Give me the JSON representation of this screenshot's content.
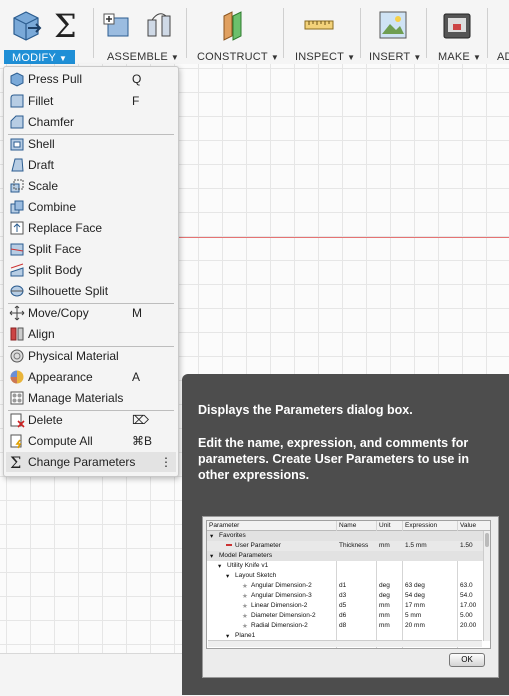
{
  "toolbar": {
    "groups": [
      {
        "label": "MODIFY",
        "active": true
      },
      {
        "label": "ASSEMBLE"
      },
      {
        "label": "CONSTRUCT"
      },
      {
        "label": "INSPECT"
      },
      {
        "label": "INSERT"
      },
      {
        "label": "MAKE"
      },
      {
        "label": "AD"
      }
    ]
  },
  "menu": {
    "items": [
      {
        "label": "Press Pull",
        "key": "Q",
        "icon": "press-pull-icon"
      },
      {
        "label": "Fillet",
        "key": "F",
        "icon": "fillet-icon"
      },
      {
        "label": "Chamfer",
        "key": "",
        "icon": "chamfer-icon"
      },
      {
        "label": "Shell",
        "key": "",
        "icon": "shell-icon"
      },
      {
        "label": "Draft",
        "key": "",
        "icon": "draft-icon"
      },
      {
        "label": "Scale",
        "key": "",
        "icon": "scale-icon"
      },
      {
        "label": "Combine",
        "key": "",
        "icon": "combine-icon"
      },
      {
        "label": "Replace Face",
        "key": "",
        "icon": "replace-face-icon"
      },
      {
        "label": "Split Face",
        "key": "",
        "icon": "split-face-icon"
      },
      {
        "label": "Split Body",
        "key": "",
        "icon": "split-body-icon"
      },
      {
        "label": "Silhouette Split",
        "key": "",
        "icon": "silhouette-split-icon"
      },
      {
        "label": "Move/Copy",
        "key": "M",
        "icon": "move-copy-icon"
      },
      {
        "label": "Align",
        "key": "",
        "icon": "align-icon"
      },
      {
        "label": "Physical Material",
        "key": "",
        "icon": "physical-material-icon"
      },
      {
        "label": "Appearance",
        "key": "A",
        "icon": "appearance-icon"
      },
      {
        "label": "Manage Materials",
        "key": "",
        "icon": "manage-materials-icon"
      },
      {
        "label": "Delete",
        "key": "⌦",
        "icon": "delete-icon"
      },
      {
        "label": "Compute All",
        "key": "⌘B",
        "icon": "compute-all-icon"
      },
      {
        "label": "Change Parameters",
        "key": "⋮",
        "icon": "change-parameters-icon"
      }
    ]
  },
  "tooltip": {
    "line1": "Displays the Parameters dialog box.",
    "line2": "Edit the name, expression, and comments for parameters. Create User Parameters to use in other expressions."
  },
  "dialog": {
    "headers": [
      "Parameter",
      "Name",
      "Unit",
      "Expression",
      "Value"
    ],
    "rows": [
      {
        "param": "Favorites",
        "name": "",
        "unit": "",
        "expr": "",
        "value": "",
        "kind": "grp",
        "indent": 0
      },
      {
        "param": "User Parameter",
        "name": "Thickness",
        "unit": "mm",
        "expr": "1.5 mm",
        "value": "1.50",
        "kind": "hl",
        "indent": 2
      },
      {
        "param": "Model Parameters",
        "name": "",
        "unit": "",
        "expr": "",
        "value": "",
        "kind": "grp",
        "indent": 0
      },
      {
        "param": "Utility Knife v1",
        "name": "",
        "unit": "",
        "expr": "",
        "value": "",
        "kind": "",
        "indent": 1
      },
      {
        "param": "Layout Sketch",
        "name": "",
        "unit": "",
        "expr": "",
        "value": "",
        "kind": "",
        "indent": 2
      },
      {
        "param": "Angular Dimension-2",
        "name": "d1",
        "unit": "deg",
        "expr": "63 deg",
        "value": "63.0",
        "kind": "",
        "indent": 4
      },
      {
        "param": "Angular Dimension-3",
        "name": "d3",
        "unit": "deg",
        "expr": "54 deg",
        "value": "54.0",
        "kind": "",
        "indent": 4
      },
      {
        "param": "Linear Dimension-2",
        "name": "d5",
        "unit": "mm",
        "expr": "17 mm",
        "value": "17.00",
        "kind": "",
        "indent": 4
      },
      {
        "param": "Diameter Dimension-2",
        "name": "d6",
        "unit": "mm",
        "expr": "5 mm",
        "value": "5.00",
        "kind": "",
        "indent": 4
      },
      {
        "param": "Radial Dimension-2",
        "name": "d8",
        "unit": "mm",
        "expr": "20 mm",
        "value": "20.00",
        "kind": "",
        "indent": 4
      },
      {
        "param": "Plane1",
        "name": "",
        "unit": "",
        "expr": "",
        "value": "",
        "kind": "",
        "indent": 2
      }
    ],
    "ok_label": "OK"
  }
}
